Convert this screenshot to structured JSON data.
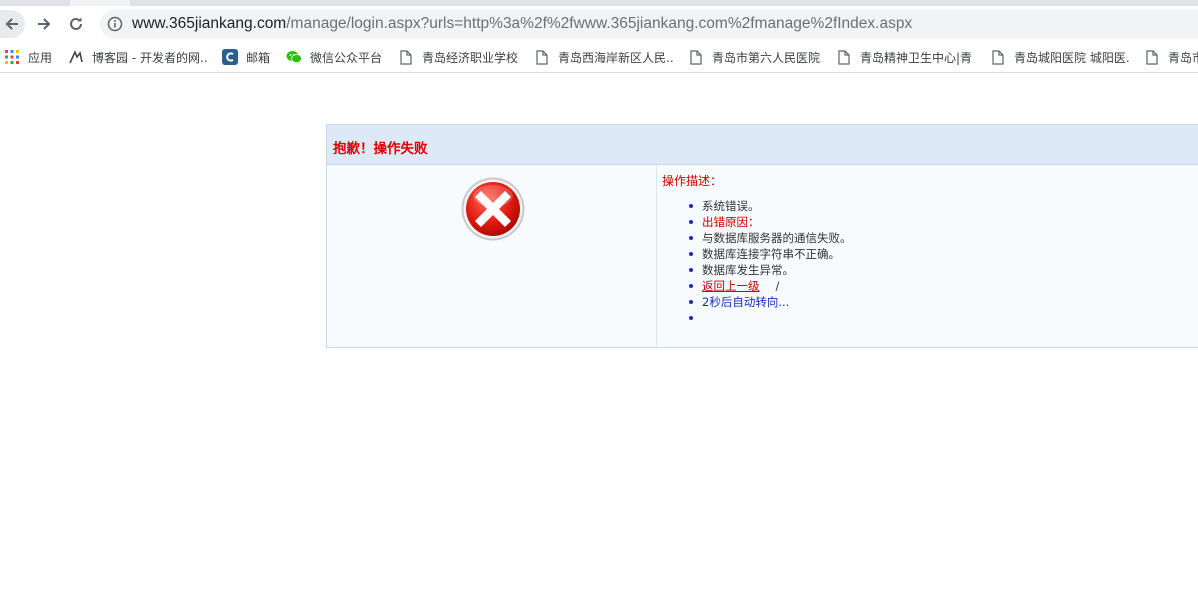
{
  "browser": {
    "url_host": "www.365jiankang.com",
    "url_rest": "/manage/login.aspx?urls=http%3a%2f%2fwww.365jiankang.com%2fmanage%2fIndex.aspx"
  },
  "bookmarks": [
    {
      "label": "应用",
      "icon": "apps-grid-icon"
    },
    {
      "label": "博客园 - 开发者的网...",
      "icon": "cnblogs-icon"
    },
    {
      "label": "邮箱",
      "icon": "mail-c-icon"
    },
    {
      "label": "微信公众平台",
      "icon": "wechat-icon"
    },
    {
      "label": "青岛经济职业学校",
      "icon": "page-icon"
    },
    {
      "label": "青岛西海岸新区人民...",
      "icon": "page-icon"
    },
    {
      "label": "青岛市第六人民医院",
      "icon": "page-icon"
    },
    {
      "label": "青岛精神卫生中心|青...",
      "icon": "page-icon"
    },
    {
      "label": "青岛城阳医院 城阳医...",
      "icon": "page-icon"
    },
    {
      "label": "青岛市",
      "icon": "page-icon"
    }
  ],
  "error": {
    "title": "抱歉！操作失败",
    "desc_label": "操作描述：",
    "items": [
      "系统错误。",
      "出错原因：",
      "与数据库服务器的通信失败。",
      "数据库连接字符串不正确。",
      "数据库发生异常。"
    ],
    "back_link": "返回上一级",
    "separator": "/",
    "redirect_text": "2秒后自动转向..."
  }
}
